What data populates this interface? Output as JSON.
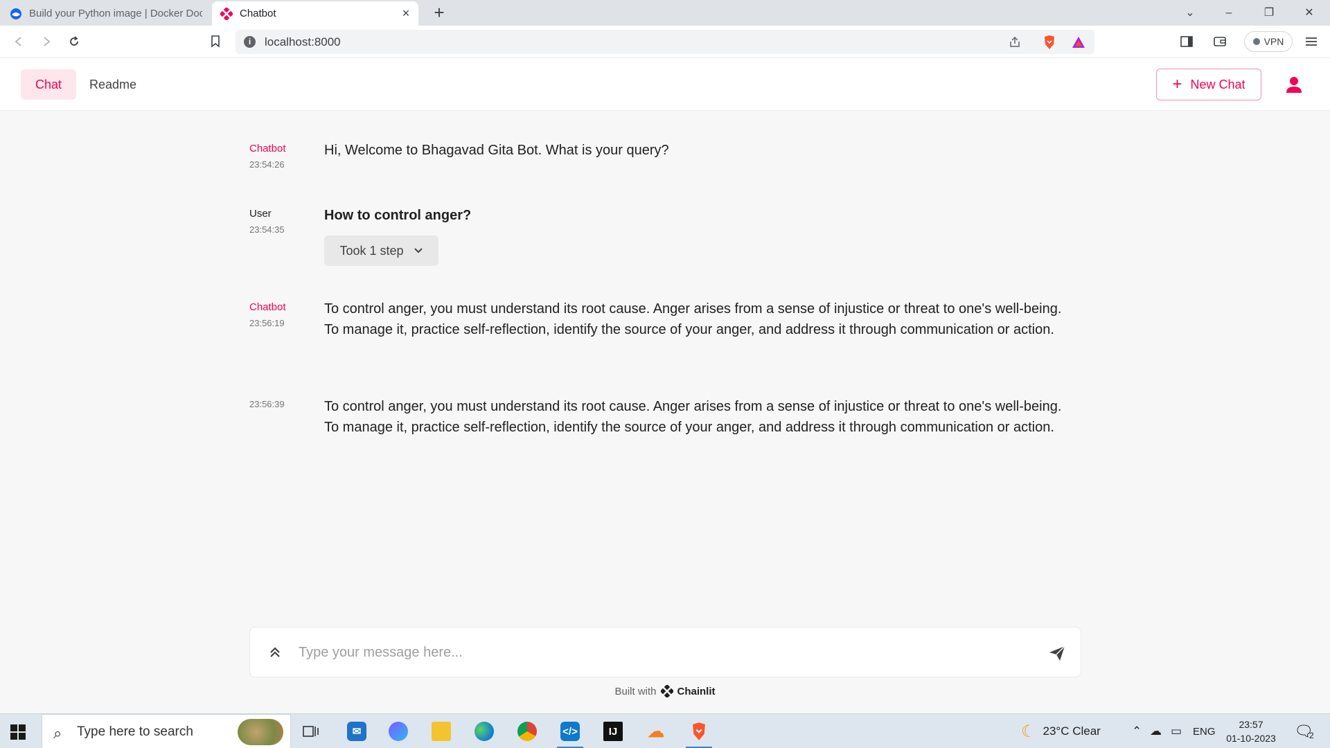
{
  "browser": {
    "tabs": [
      {
        "title": "Build your Python image | Docker Doc",
        "active": false
      },
      {
        "title": "Chatbot",
        "active": true
      }
    ],
    "url": "localhost:8000",
    "vpn_label": "VPN"
  },
  "header": {
    "nav": [
      {
        "label": "Chat",
        "active": true
      },
      {
        "label": "Readme",
        "active": false
      }
    ],
    "new_chat_label": "New Chat",
    "accent_color": "#f50057"
  },
  "messages": [
    {
      "author": "Chatbot",
      "time": "23:54:26",
      "text": "Hi, Welcome to Bhagavad Gita Bot. What is your query?"
    },
    {
      "author": "User",
      "time": "23:54:35",
      "text": "How to control anger?",
      "steps_label": "Took 1 step"
    },
    {
      "author": "Chatbot",
      "time": "23:56:19",
      "text": "To control anger, you must understand its root cause. Anger arises from a sense of injustice or threat to one's well-being. To manage it, practice self-reflection, identify the source of your anger, and address it through communication or action."
    },
    {
      "author": "",
      "time": "23:56:39",
      "text": "To control anger, you must understand its root cause. Anger arises from a sense of injustice or threat to one's well-being. To manage it, practice self-reflection, identify the source of your anger, and address it through communication or action."
    }
  ],
  "composer": {
    "placeholder": "Type your message here...",
    "footer_prefix": "Built with",
    "footer_brand": "Chainlit"
  },
  "taskbar": {
    "search_placeholder": "Type here to search",
    "apps": [
      "task-view",
      "mail",
      "copilot",
      "file-explorer",
      "edge",
      "chrome",
      "vscode",
      "intellij",
      "cloudflare",
      "brave"
    ],
    "weather": "23°C  Clear",
    "language": "ENG",
    "time": "23:57",
    "date": "01-10-2023",
    "notification_count": "2"
  }
}
